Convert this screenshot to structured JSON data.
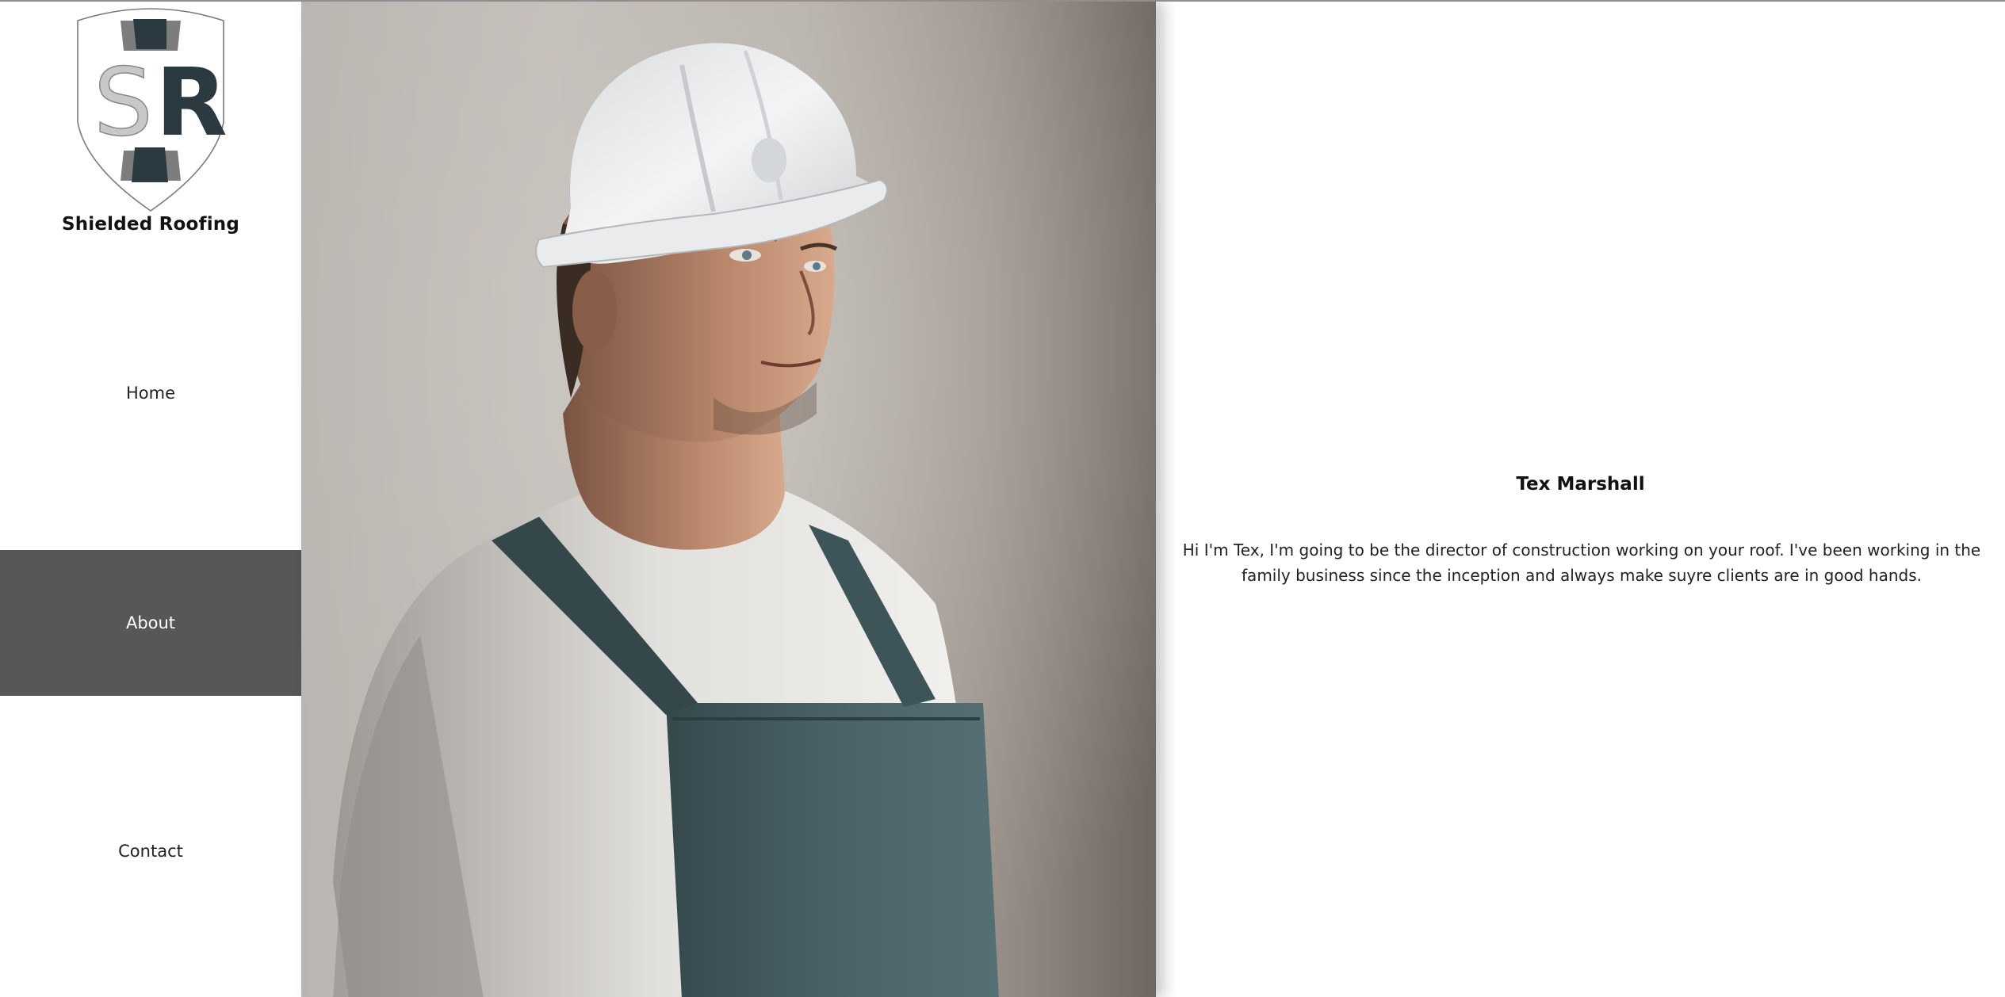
{
  "brand": {
    "logo_letters": "SR",
    "name": "Shielded Roofing"
  },
  "nav": {
    "items": [
      {
        "label": "Home",
        "active": false
      },
      {
        "label": "About",
        "active": true
      },
      {
        "label": "Contact",
        "active": false
      }
    ]
  },
  "about": {
    "name": "Tex Marshall",
    "bio": "Hi I'm Tex, I'm going to be the director of construction working on your roof. I've been working in the family business since the inception and always make suyre clients are in good hands."
  },
  "colors": {
    "active_nav_bg": "#575757",
    "logo_dark": "#2b3a40",
    "logo_light": "#c8c8c8"
  }
}
